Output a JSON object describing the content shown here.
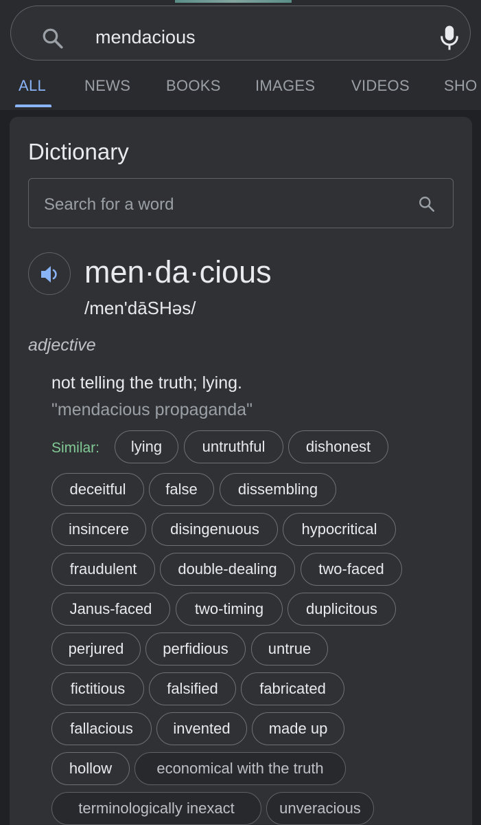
{
  "search": {
    "query": "mendacious",
    "icon": "search-icon",
    "mic_icon": "mic-icon"
  },
  "tabs": [
    {
      "label": "ALL",
      "active": true
    },
    {
      "label": "NEWS"
    },
    {
      "label": "BOOKS"
    },
    {
      "label": "IMAGES"
    },
    {
      "label": "VIDEOS"
    },
    {
      "label": "SHO"
    }
  ],
  "dictionary": {
    "title": "Dictionary",
    "search_placeholder": "Search for a word",
    "headword": "men·da·cious",
    "phonetic": "/men'dāSHəs/",
    "part_of_speech": "adjective",
    "definition": "not telling the truth; lying.",
    "example": "\"mendacious propaganda\"",
    "similar_label": "Similar:",
    "similar": [
      "lying",
      "untruthful",
      "dishonest",
      "deceitful",
      "false",
      "dissembling",
      "insincere",
      "disingenuous",
      "hypocritical",
      "fraudulent",
      "double-dealing",
      "two-faced",
      "Janus-faced",
      "two-timing",
      "duplicitous",
      "perjured",
      "perfidious",
      "untrue",
      "fictitious",
      "falsified",
      "fabricated",
      "fallacious",
      "invented",
      "made up",
      "hollow",
      "economical with the truth",
      "terminologically inexact",
      "unveracious"
    ]
  },
  "colors": {
    "accent": "#8ab4f8",
    "similar_label": "#81c995",
    "background": "#202124",
    "card": "#303134"
  }
}
